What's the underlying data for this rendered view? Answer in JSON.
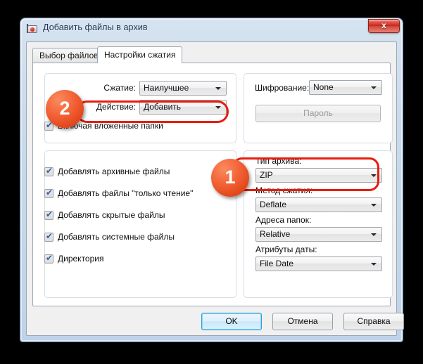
{
  "window": {
    "title": "Добавить файлы в архив",
    "icon": "archiver-app-icon",
    "close_label": "x"
  },
  "tabs": [
    {
      "label": "Выбор файлов",
      "active": false
    },
    {
      "label": "Настройки сжатия",
      "active": true
    }
  ],
  "left_panel": {
    "compression": {
      "label": "Сжатие:",
      "value": "Наилучшее"
    },
    "action": {
      "label": "Действие:",
      "value": "Добавить"
    },
    "include_subfolders": {
      "label": "Включая вложенные папки",
      "checked": true
    },
    "options": [
      {
        "label": "Добавлять архивные файлы",
        "checked": true
      },
      {
        "label": "Добавлять файлы \"только чтение\"",
        "checked": true
      },
      {
        "label": "Добавлять скрытые файлы",
        "checked": true
      },
      {
        "label": "Добавлять системные файлы",
        "checked": true
      },
      {
        "label": "Директория",
        "checked": true
      }
    ]
  },
  "right_panel": {
    "encryption": {
      "label": "Шифрование:",
      "value": "None"
    },
    "password_button": {
      "label": "Пароль",
      "disabled": true
    },
    "archive_type": {
      "label": "Тип архива:",
      "value": "ZIP"
    },
    "compression_method": {
      "label": "Метод сжатия:",
      "value": "Deflate"
    },
    "folder_paths": {
      "label": "Адреса папок:",
      "value": "Relative"
    },
    "date_attributes": {
      "label": "Атрибуты даты:",
      "value": "File Date"
    }
  },
  "footer": {
    "ok": "OK",
    "cancel": "Отмена",
    "help": "Справка"
  },
  "annotations": {
    "badge_one": "1",
    "badge_two": "2",
    "highlight_color": "#e81c0d",
    "badge_color": "#e4491d"
  }
}
